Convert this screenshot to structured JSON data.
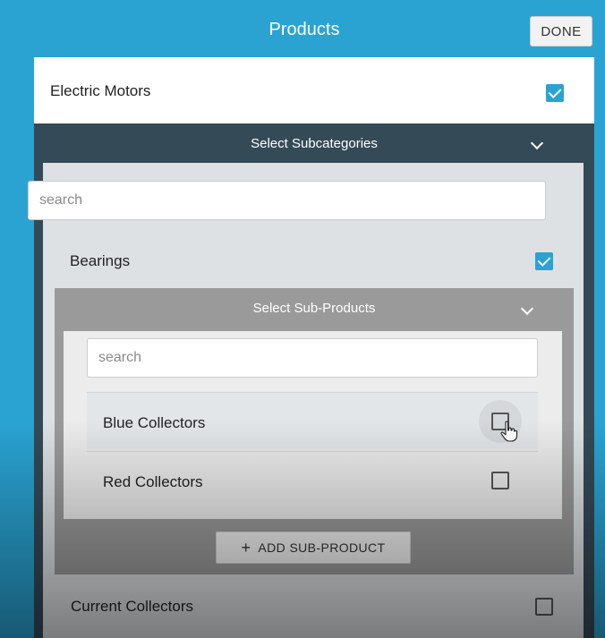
{
  "header": {
    "title": "Products",
    "done_label": "DONE"
  },
  "category": {
    "label": "Electric Motors",
    "checked": true
  },
  "subcategories": {
    "header_label": "Select Subcategories",
    "search_placeholder": "search",
    "items": [
      {
        "label": "Bearings",
        "checked": true
      },
      {
        "label": "Current Collectors",
        "checked": false
      }
    ]
  },
  "subproducts": {
    "header_label": "Select Sub-Products",
    "search_placeholder": "search",
    "items": [
      {
        "label": "Blue Collectors",
        "checked": false,
        "hovered": true
      },
      {
        "label": "Red Collectors",
        "checked": false
      }
    ],
    "add_button_label": "ADD SUB-PRODUCT",
    "add_button_icon": "plus-icon"
  },
  "colors": {
    "accent": "#2aa3d3",
    "section_dark": "#344a57",
    "section_gray": "#9a9a9a"
  }
}
